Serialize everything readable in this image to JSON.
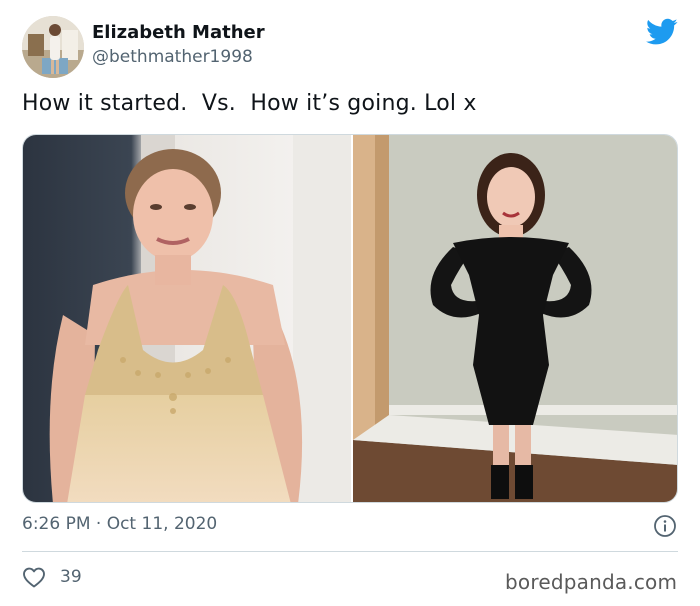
{
  "tweet": {
    "author": {
      "name": "Elizabeth Mather",
      "handle": "@bethmather1998"
    },
    "text": "How it started.  Vs.  How it’s going. Lol x",
    "timestamp": "6:26 PM · Oct 11, 2020",
    "likes": "39",
    "icons": {
      "brand": "twitter-bird-icon",
      "info": "info-icon",
      "like": "heart-icon"
    }
  },
  "watermark": "boredpanda.com",
  "colors": {
    "twitter_blue": "#1d9bf0",
    "text_primary": "#0f1419",
    "text_secondary": "#536471",
    "divider": "#cfd9de"
  }
}
